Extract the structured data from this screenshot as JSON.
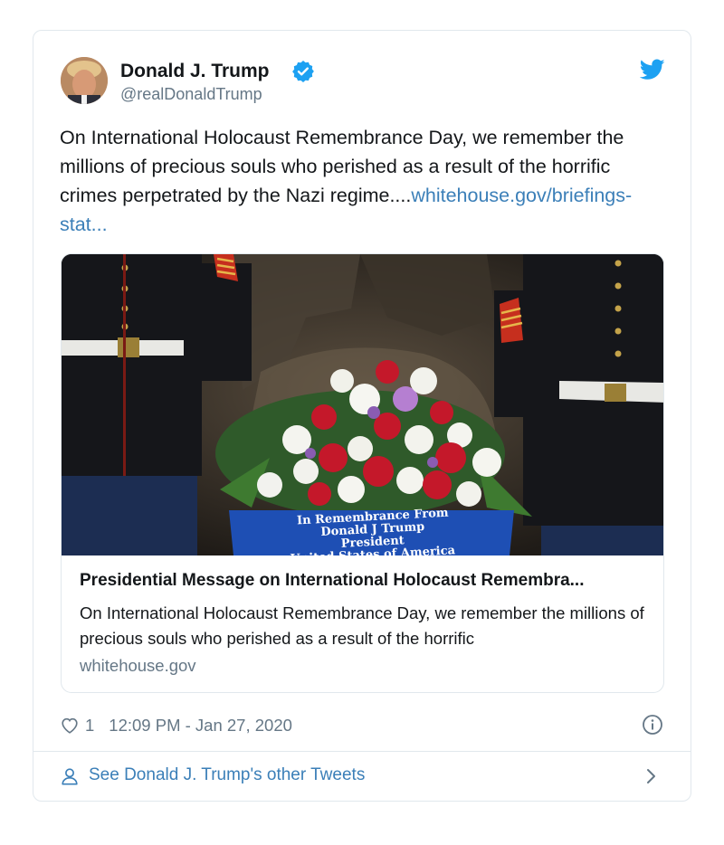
{
  "author": {
    "name": "Donald J. Trump",
    "handle": "@realDonaldTrump"
  },
  "tweet": {
    "text": "On International Holocaust Remembrance Day, we remember the millions of precious souls who perished as a result of the horrific crimes perpetrated by the Nazi regime....",
    "link_text": "whitehouse.gov/briefings-stat..."
  },
  "link_card": {
    "image_caption_lines": [
      "In Remembrance From",
      "Donald J Trump",
      "President",
      "United States of America"
    ],
    "title": "Presidential Message on International Holocaust Remembra...",
    "description": "On International Holocaust Remembrance Day, we remember the millions of precious souls who perished as a result of the horrific",
    "domain": "whitehouse.gov"
  },
  "meta": {
    "likes": "1",
    "timestamp": "12:09 PM - Jan 27, 2020"
  },
  "footer": {
    "label": "See Donald J. Trump's other Tweets"
  },
  "colors": {
    "link": "#3b7fb8",
    "twitter_blue": "#1da1f2",
    "muted": "#657786",
    "border": "#e1e8ed"
  },
  "icons": [
    "verified-badge-icon",
    "twitter-bird-icon",
    "heart-icon",
    "info-icon",
    "person-icon",
    "chevron-right-icon"
  ]
}
